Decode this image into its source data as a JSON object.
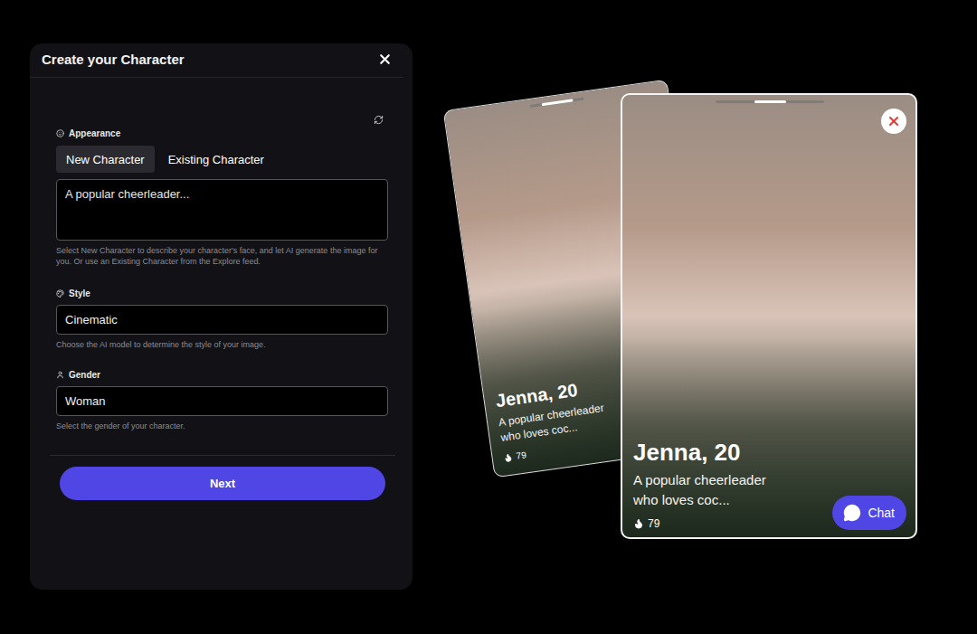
{
  "panel": {
    "title": "Create your Character",
    "appearance": {
      "label": "Appearance",
      "tabs": [
        {
          "label": "New Character",
          "selected": true
        },
        {
          "label": "Existing Character",
          "selected": false
        }
      ],
      "value": "A popular cheerleader...",
      "help": "Select New Character to describe your character's face, and let AI generate the image for you. Or use an Existing Character from the Explore feed."
    },
    "style": {
      "label": "Style",
      "value": "Cinematic",
      "help": "Choose the AI model to determine the style of your image."
    },
    "gender": {
      "label": "Gender",
      "value": "Woman",
      "help": "Select the gender of your character."
    },
    "next_button": "Next"
  },
  "cards": [
    {
      "name": "Jenna, 20",
      "description": [
        "A popular cheerleader",
        "who loves coc..."
      ],
      "likes": "79",
      "front": false
    },
    {
      "name": "Jenna, 20",
      "description": [
        "A popular cheerleader",
        "who loves coc..."
      ],
      "likes": "79",
      "front": true,
      "chat_button": "Chat"
    }
  ]
}
